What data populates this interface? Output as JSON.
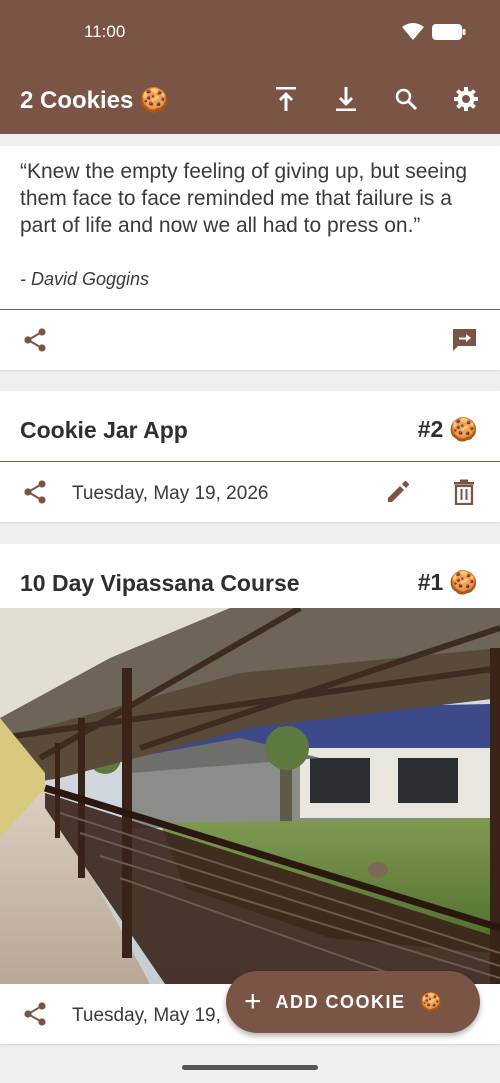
{
  "status_bar": {
    "time": "11:00"
  },
  "app_bar": {
    "title": "2 Cookies",
    "title_emoji": "🍪",
    "actions": [
      "upload-icon",
      "download-icon",
      "search-icon",
      "gear-icon"
    ]
  },
  "quote": {
    "text": "“Knew the empty feeling of giving up, but seeing them face to face reminded me that failure is a part of life and now we all had to press on.”",
    "author": "- David Goggins"
  },
  "cookies": [
    {
      "title": "Cookie Jar App",
      "number": "#2",
      "emoji": "🍪",
      "date": "Tuesday, May 19, 2026"
    },
    {
      "title": "10 Day Vipassana Course",
      "number": "#1",
      "emoji": "🍪",
      "date": "Tuesday, May 19,"
    }
  ],
  "fab": {
    "icon": "+",
    "label": "ADD COOKIE",
    "emoji": "🍪"
  },
  "colors": {
    "primary": "#7a5444",
    "background": "#efefef",
    "card": "#ffffff"
  }
}
